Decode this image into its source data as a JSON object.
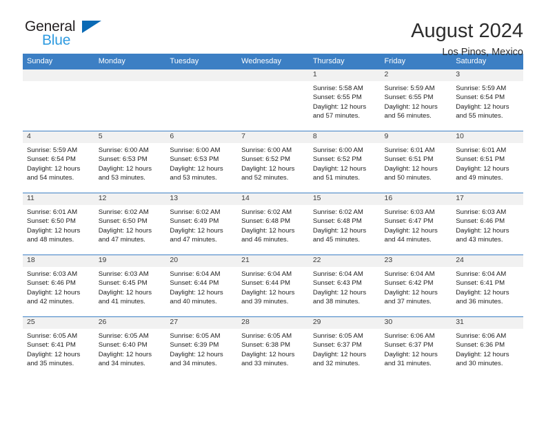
{
  "brand": {
    "name_part1": "General",
    "name_part2": "Blue",
    "accent_blue": "#2f9be0",
    "logo_triangle_color": "#0a6ab5"
  },
  "header": {
    "title": "August 2024",
    "subtitle": "Los Pinos, Mexico",
    "header_bar_color": "#3c7fc4"
  },
  "weekday_headers": [
    "Sunday",
    "Monday",
    "Tuesday",
    "Wednesday",
    "Thursday",
    "Friday",
    "Saturday"
  ],
  "labels": {
    "sunrise_prefix": "Sunrise:",
    "sunset_prefix": "Sunset:",
    "daylight_prefix": "Daylight:"
  },
  "weeks": [
    [
      {
        "day": "",
        "sunrise": "",
        "sunset": "",
        "daylight_line1": "",
        "daylight_line2": ""
      },
      {
        "day": "",
        "sunrise": "",
        "sunset": "",
        "daylight_line1": "",
        "daylight_line2": ""
      },
      {
        "day": "",
        "sunrise": "",
        "sunset": "",
        "daylight_line1": "",
        "daylight_line2": ""
      },
      {
        "day": "",
        "sunrise": "",
        "sunset": "",
        "daylight_line1": "",
        "daylight_line2": ""
      },
      {
        "day": "1",
        "sunrise": "Sunrise: 5:58 AM",
        "sunset": "Sunset: 6:55 PM",
        "daylight_line1": "Daylight: 12 hours",
        "daylight_line2": "and 57 minutes."
      },
      {
        "day": "2",
        "sunrise": "Sunrise: 5:59 AM",
        "sunset": "Sunset: 6:55 PM",
        "daylight_line1": "Daylight: 12 hours",
        "daylight_line2": "and 56 minutes."
      },
      {
        "day": "3",
        "sunrise": "Sunrise: 5:59 AM",
        "sunset": "Sunset: 6:54 PM",
        "daylight_line1": "Daylight: 12 hours",
        "daylight_line2": "and 55 minutes."
      }
    ],
    [
      {
        "day": "4",
        "sunrise": "Sunrise: 5:59 AM",
        "sunset": "Sunset: 6:54 PM",
        "daylight_line1": "Daylight: 12 hours",
        "daylight_line2": "and 54 minutes."
      },
      {
        "day": "5",
        "sunrise": "Sunrise: 6:00 AM",
        "sunset": "Sunset: 6:53 PM",
        "daylight_line1": "Daylight: 12 hours",
        "daylight_line2": "and 53 minutes."
      },
      {
        "day": "6",
        "sunrise": "Sunrise: 6:00 AM",
        "sunset": "Sunset: 6:53 PM",
        "daylight_line1": "Daylight: 12 hours",
        "daylight_line2": "and 53 minutes."
      },
      {
        "day": "7",
        "sunrise": "Sunrise: 6:00 AM",
        "sunset": "Sunset: 6:52 PM",
        "daylight_line1": "Daylight: 12 hours",
        "daylight_line2": "and 52 minutes."
      },
      {
        "day": "8",
        "sunrise": "Sunrise: 6:00 AM",
        "sunset": "Sunset: 6:52 PM",
        "daylight_line1": "Daylight: 12 hours",
        "daylight_line2": "and 51 minutes."
      },
      {
        "day": "9",
        "sunrise": "Sunrise: 6:01 AM",
        "sunset": "Sunset: 6:51 PM",
        "daylight_line1": "Daylight: 12 hours",
        "daylight_line2": "and 50 minutes."
      },
      {
        "day": "10",
        "sunrise": "Sunrise: 6:01 AM",
        "sunset": "Sunset: 6:51 PM",
        "daylight_line1": "Daylight: 12 hours",
        "daylight_line2": "and 49 minutes."
      }
    ],
    [
      {
        "day": "11",
        "sunrise": "Sunrise: 6:01 AM",
        "sunset": "Sunset: 6:50 PM",
        "daylight_line1": "Daylight: 12 hours",
        "daylight_line2": "and 48 minutes."
      },
      {
        "day": "12",
        "sunrise": "Sunrise: 6:02 AM",
        "sunset": "Sunset: 6:50 PM",
        "daylight_line1": "Daylight: 12 hours",
        "daylight_line2": "and 47 minutes."
      },
      {
        "day": "13",
        "sunrise": "Sunrise: 6:02 AM",
        "sunset": "Sunset: 6:49 PM",
        "daylight_line1": "Daylight: 12 hours",
        "daylight_line2": "and 47 minutes."
      },
      {
        "day": "14",
        "sunrise": "Sunrise: 6:02 AM",
        "sunset": "Sunset: 6:48 PM",
        "daylight_line1": "Daylight: 12 hours",
        "daylight_line2": "and 46 minutes."
      },
      {
        "day": "15",
        "sunrise": "Sunrise: 6:02 AM",
        "sunset": "Sunset: 6:48 PM",
        "daylight_line1": "Daylight: 12 hours",
        "daylight_line2": "and 45 minutes."
      },
      {
        "day": "16",
        "sunrise": "Sunrise: 6:03 AM",
        "sunset": "Sunset: 6:47 PM",
        "daylight_line1": "Daylight: 12 hours",
        "daylight_line2": "and 44 minutes."
      },
      {
        "day": "17",
        "sunrise": "Sunrise: 6:03 AM",
        "sunset": "Sunset: 6:46 PM",
        "daylight_line1": "Daylight: 12 hours",
        "daylight_line2": "and 43 minutes."
      }
    ],
    [
      {
        "day": "18",
        "sunrise": "Sunrise: 6:03 AM",
        "sunset": "Sunset: 6:46 PM",
        "daylight_line1": "Daylight: 12 hours",
        "daylight_line2": "and 42 minutes."
      },
      {
        "day": "19",
        "sunrise": "Sunrise: 6:03 AM",
        "sunset": "Sunset: 6:45 PM",
        "daylight_line1": "Daylight: 12 hours",
        "daylight_line2": "and 41 minutes."
      },
      {
        "day": "20",
        "sunrise": "Sunrise: 6:04 AM",
        "sunset": "Sunset: 6:44 PM",
        "daylight_line1": "Daylight: 12 hours",
        "daylight_line2": "and 40 minutes."
      },
      {
        "day": "21",
        "sunrise": "Sunrise: 6:04 AM",
        "sunset": "Sunset: 6:44 PM",
        "daylight_line1": "Daylight: 12 hours",
        "daylight_line2": "and 39 minutes."
      },
      {
        "day": "22",
        "sunrise": "Sunrise: 6:04 AM",
        "sunset": "Sunset: 6:43 PM",
        "daylight_line1": "Daylight: 12 hours",
        "daylight_line2": "and 38 minutes."
      },
      {
        "day": "23",
        "sunrise": "Sunrise: 6:04 AM",
        "sunset": "Sunset: 6:42 PM",
        "daylight_line1": "Daylight: 12 hours",
        "daylight_line2": "and 37 minutes."
      },
      {
        "day": "24",
        "sunrise": "Sunrise: 6:04 AM",
        "sunset": "Sunset: 6:41 PM",
        "daylight_line1": "Daylight: 12 hours",
        "daylight_line2": "and 36 minutes."
      }
    ],
    [
      {
        "day": "25",
        "sunrise": "Sunrise: 6:05 AM",
        "sunset": "Sunset: 6:41 PM",
        "daylight_line1": "Daylight: 12 hours",
        "daylight_line2": "and 35 minutes."
      },
      {
        "day": "26",
        "sunrise": "Sunrise: 6:05 AM",
        "sunset": "Sunset: 6:40 PM",
        "daylight_line1": "Daylight: 12 hours",
        "daylight_line2": "and 34 minutes."
      },
      {
        "day": "27",
        "sunrise": "Sunrise: 6:05 AM",
        "sunset": "Sunset: 6:39 PM",
        "daylight_line1": "Daylight: 12 hours",
        "daylight_line2": "and 34 minutes."
      },
      {
        "day": "28",
        "sunrise": "Sunrise: 6:05 AM",
        "sunset": "Sunset: 6:38 PM",
        "daylight_line1": "Daylight: 12 hours",
        "daylight_line2": "and 33 minutes."
      },
      {
        "day": "29",
        "sunrise": "Sunrise: 6:05 AM",
        "sunset": "Sunset: 6:37 PM",
        "daylight_line1": "Daylight: 12 hours",
        "daylight_line2": "and 32 minutes."
      },
      {
        "day": "30",
        "sunrise": "Sunrise: 6:06 AM",
        "sunset": "Sunset: 6:37 PM",
        "daylight_line1": "Daylight: 12 hours",
        "daylight_line2": "and 31 minutes."
      },
      {
        "day": "31",
        "sunrise": "Sunrise: 6:06 AM",
        "sunset": "Sunset: 6:36 PM",
        "daylight_line1": "Daylight: 12 hours",
        "daylight_line2": "and 30 minutes."
      }
    ]
  ]
}
